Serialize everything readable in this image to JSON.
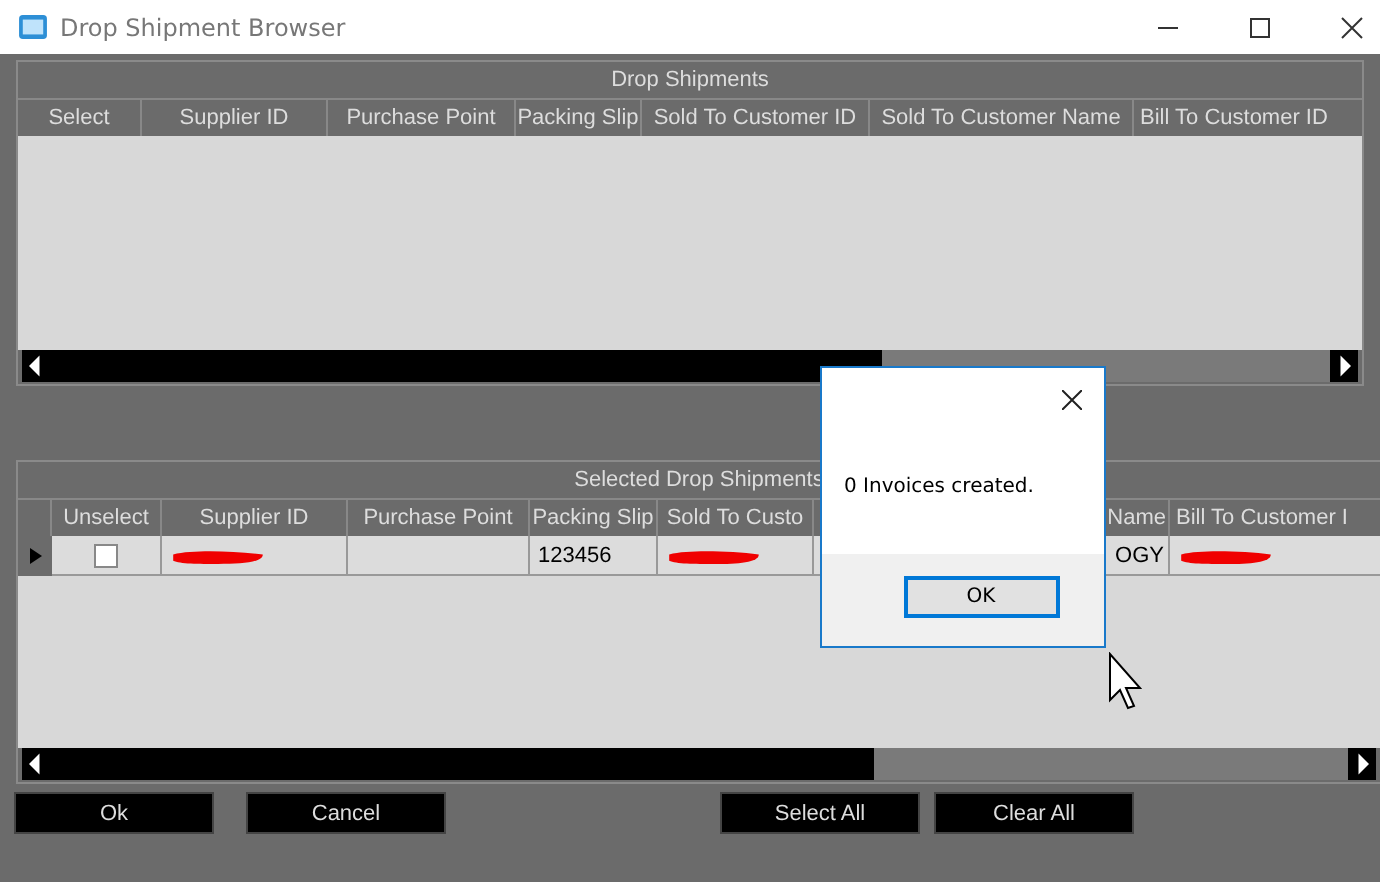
{
  "window": {
    "title": "Drop Shipment Browser"
  },
  "drop_shipments": {
    "title": "Drop Shipments",
    "columns": [
      "Select",
      "Supplier ID",
      "Purchase Point",
      "Packing Slip",
      "Sold To Customer ID",
      "Sold To Customer Name",
      "Bill To Customer ID"
    ]
  },
  "selected_drop_shipments": {
    "title": "Selected Drop Shipments",
    "columns": [
      "Unselect",
      "Supplier ID",
      "Purchase Point",
      "Packing Slip",
      "Sold To Custo",
      "",
      "Name",
      "Bill To Customer I"
    ],
    "rows": [
      {
        "selected": true,
        "cells": [
          {
            "kind": "checkbox",
            "checked": false
          },
          {
            "kind": "redacted"
          },
          {
            "kind": "empty"
          },
          {
            "kind": "text",
            "text": "123456"
          },
          {
            "kind": "redacted"
          },
          {
            "kind": "empty"
          },
          {
            "kind": "text",
            "text": "OGY"
          },
          {
            "kind": "redacted"
          }
        ]
      }
    ]
  },
  "buttons": [
    {
      "label": "Ok"
    },
    {
      "label": "Cancel"
    },
    {
      "label": "Select All"
    },
    {
      "label": "Clear All"
    }
  ],
  "dialog": {
    "message": "0 Invoices created.",
    "button": "OK"
  }
}
